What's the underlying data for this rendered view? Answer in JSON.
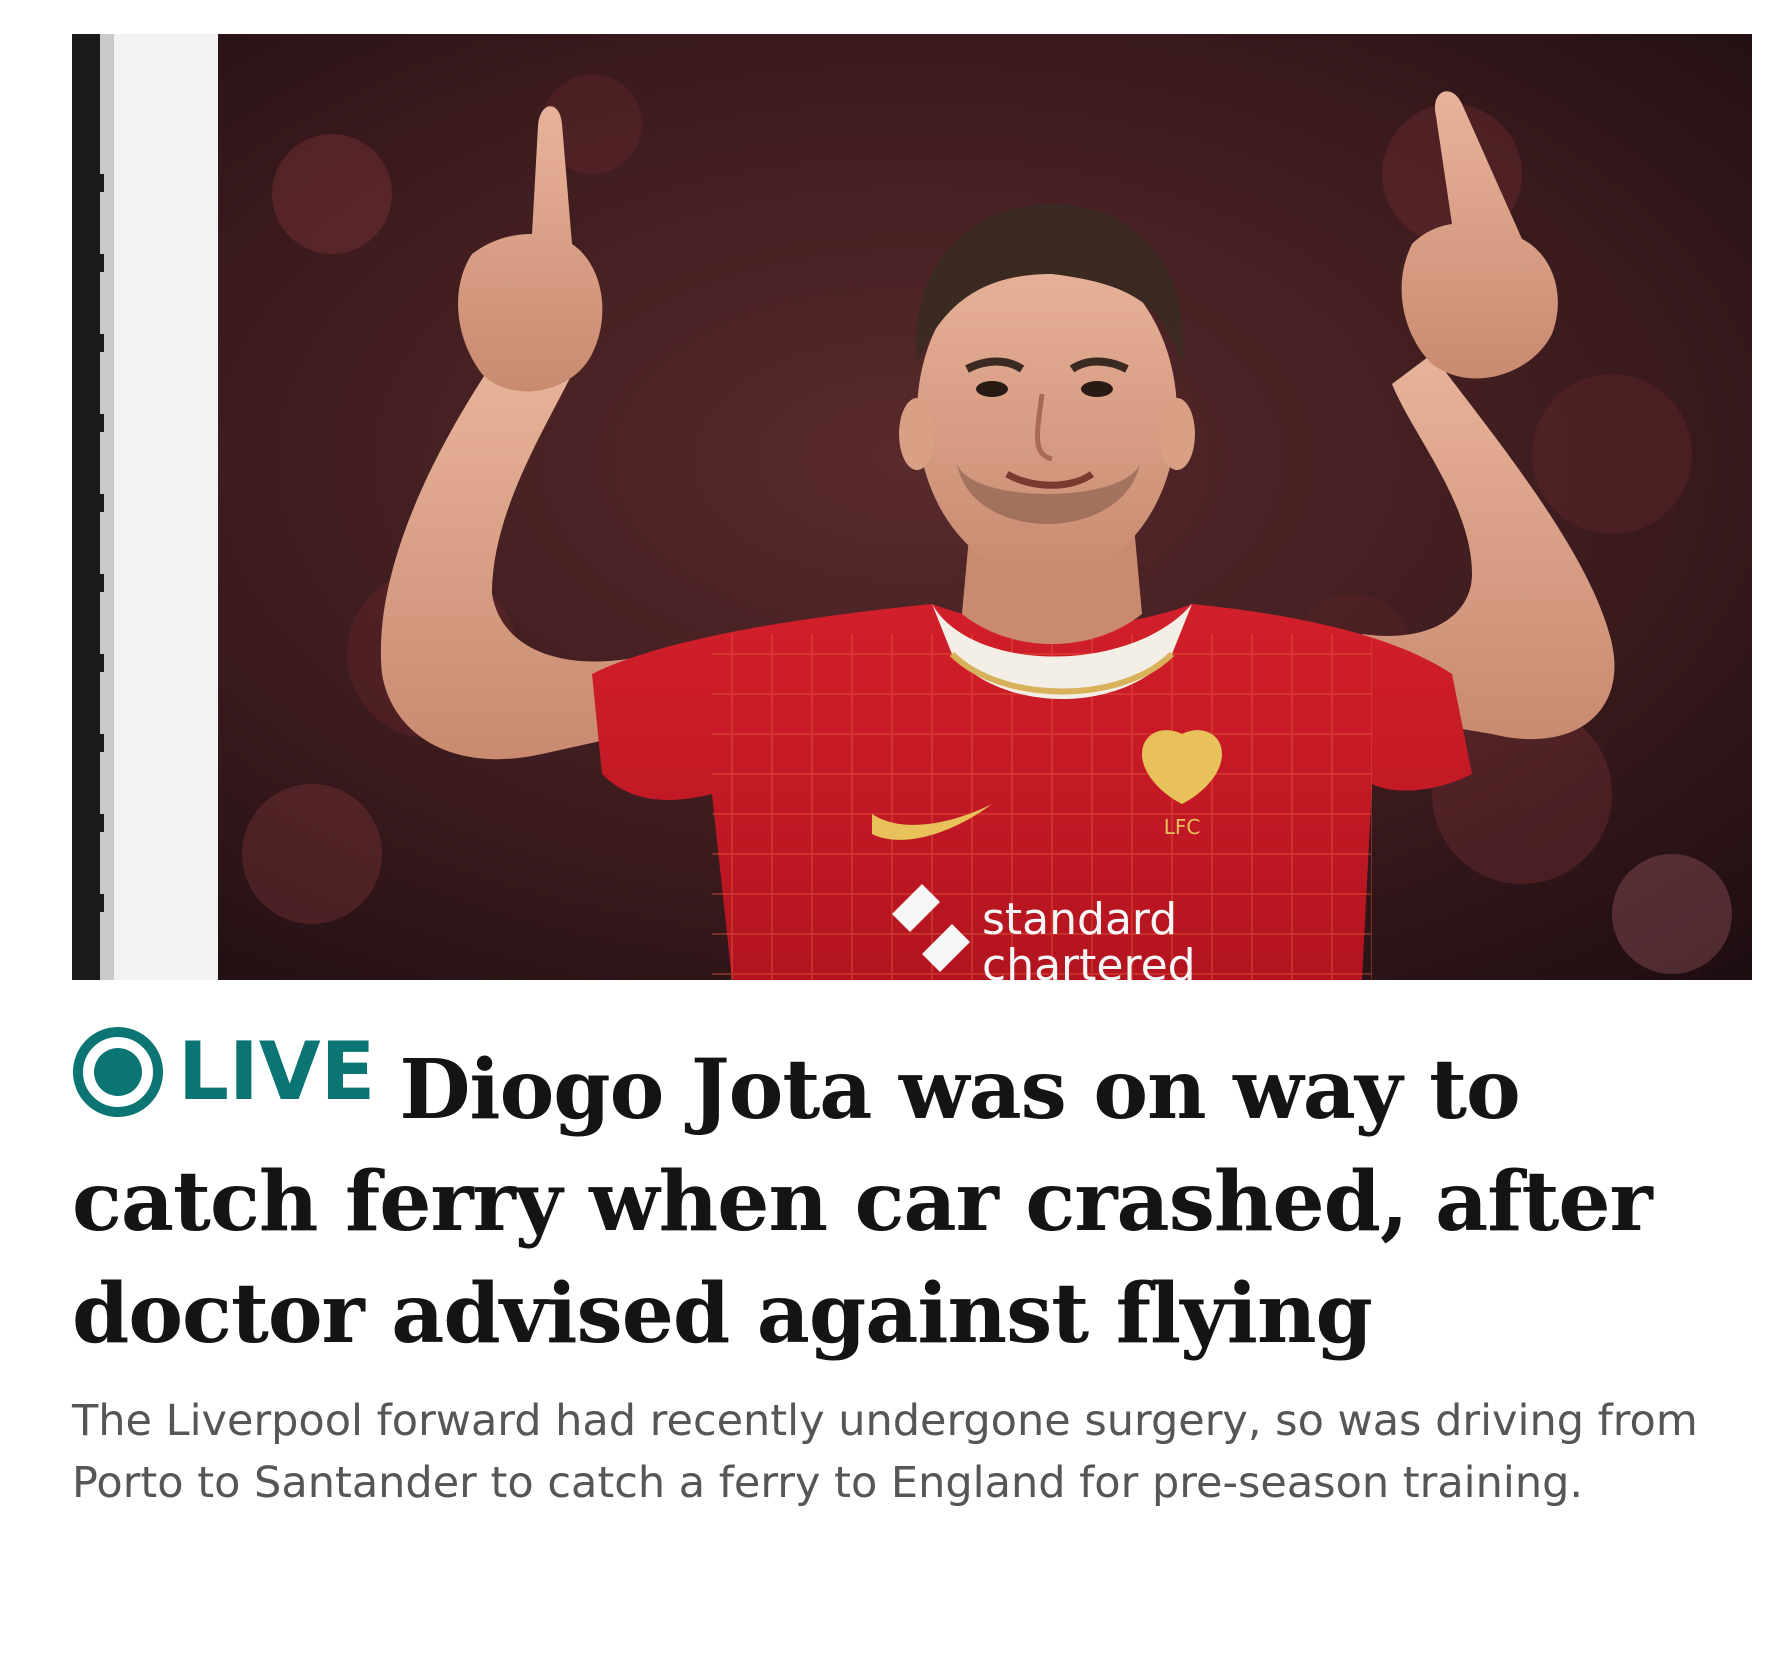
{
  "article": {
    "image": {
      "alt": "Diogo Jota celebrating in a red Liverpool shirt, both index fingers pointing up",
      "sponsor_text_line1": "standard",
      "sponsor_text_line2": "chartered",
      "crest_text": "LFC"
    },
    "live_label": "LIVE",
    "headline": "Diogo Jota was on way to catch ferry when car crashed, after doctor advised against flying",
    "summary": "The Liverpool forward had recently undergone surgery, so was driving from Porto to Santander to catch a ferry to England for pre-season training.",
    "colors": {
      "live_accent": "#0a7573",
      "headline": "#141414",
      "summary": "#545658"
    },
    "icons": {
      "live": "live-indicator-icon"
    }
  }
}
